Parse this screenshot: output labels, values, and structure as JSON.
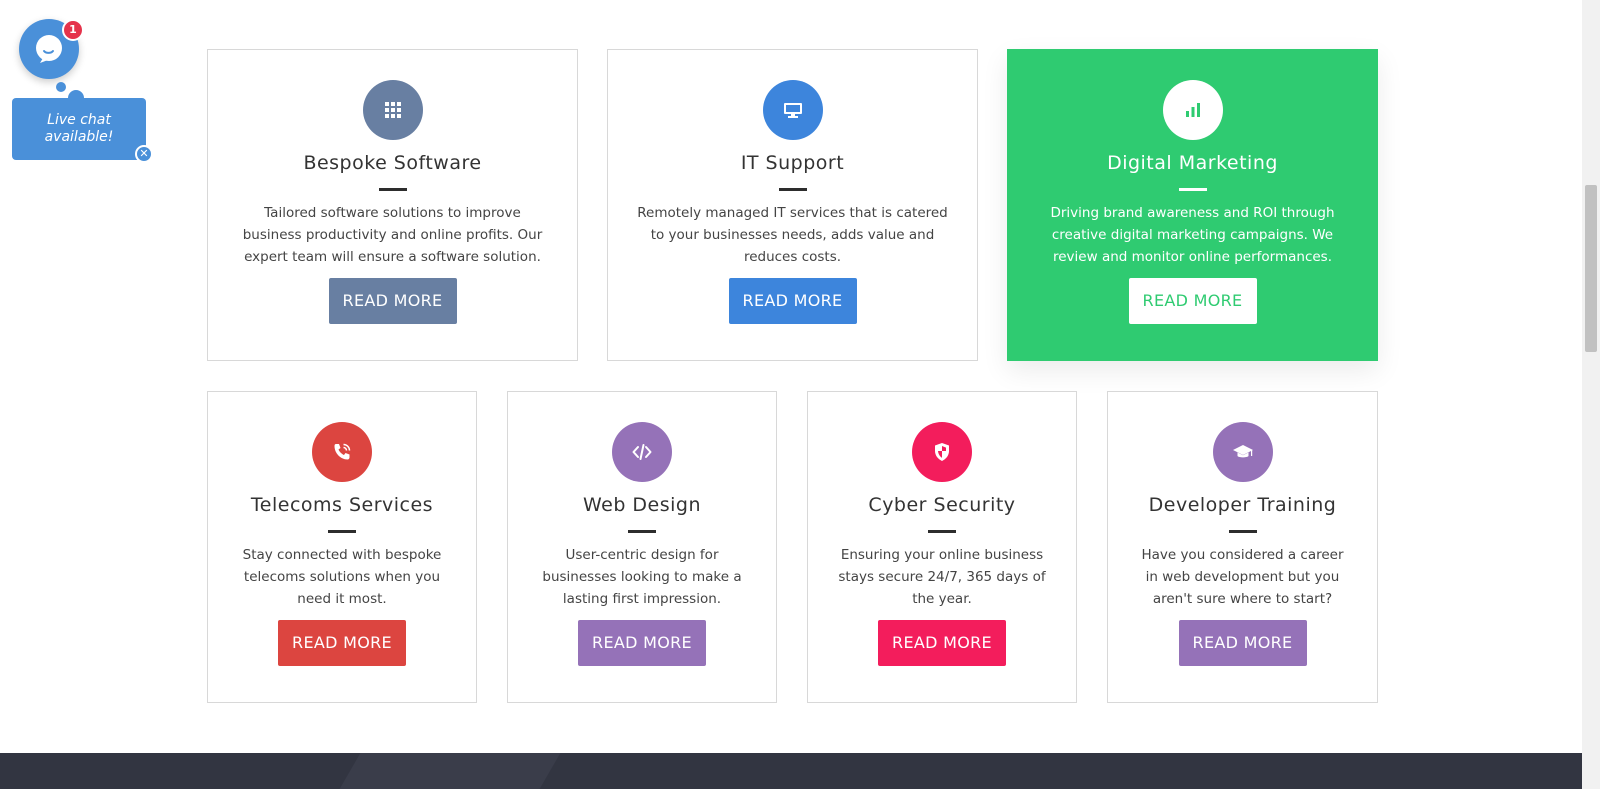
{
  "chat": {
    "badge_count": "1",
    "tooltip": "Live chat available!",
    "close_symbol": "✕"
  },
  "services": [
    {
      "title": "Bespoke Software",
      "description": "Tailored software solutions to improve business productivity and online profits. Our expert team will ensure a software solution.",
      "button": "READ MORE",
      "icon": "grid-icon",
      "color": "#687fa2"
    },
    {
      "title": "IT Support",
      "description": "Remotely managed IT services that is catered to your businesses needs, adds value and reduces costs.",
      "button": "READ MORE",
      "icon": "monitor-icon",
      "color": "#3d85dc"
    },
    {
      "title": "Digital Marketing",
      "description": "Driving brand awareness and ROI through creative digital marketing campaigns. We review and monitor online performances.",
      "button": "READ MORE",
      "icon": "bar-chart-icon",
      "color": "#2fcb71"
    },
    {
      "title": "Telecoms Services",
      "description": "Stay connected with bespoke telecoms solutions when you need it most.",
      "button": "READ MORE",
      "icon": "phone-icon",
      "color": "#dc4540"
    },
    {
      "title": "Web Design",
      "description": "User-centric design for businesses looking to make a lasting first impression.",
      "button": "READ MORE",
      "icon": "code-icon",
      "color": "#9572b8"
    },
    {
      "title": "Cyber Security",
      "description": "Ensuring your online business stays secure 24/7, 365 days of the year.",
      "button": "READ MORE",
      "icon": "shield-icon",
      "color": "#f31d5c"
    },
    {
      "title": "Developer Training",
      "description": "Have you considered a career in web development but you aren't sure where to start?",
      "button": "READ MORE",
      "icon": "graduation-cap-icon",
      "color": "#9572b8"
    }
  ]
}
